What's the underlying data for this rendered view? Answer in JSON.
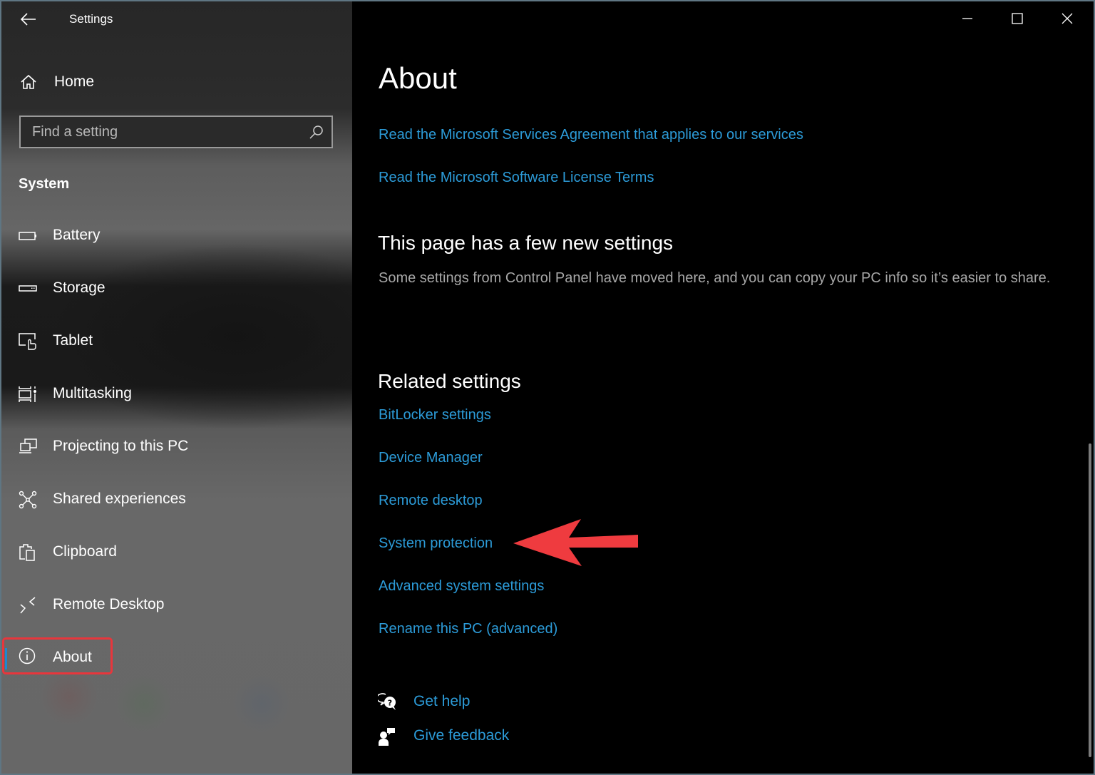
{
  "window": {
    "title": "Settings",
    "controls": {
      "minimize": "minimize-icon",
      "maximize": "maximize-icon",
      "close": "close-icon"
    }
  },
  "sidebar": {
    "back_icon": "back-arrow-icon",
    "home_label": "Home",
    "search": {
      "placeholder": "Find a setting",
      "value": ""
    },
    "section_title": "System",
    "items": [
      {
        "label": "Battery",
        "icon": "battery-icon"
      },
      {
        "label": "Storage",
        "icon": "storage-icon"
      },
      {
        "label": "Tablet",
        "icon": "tablet-icon"
      },
      {
        "label": "Multitasking",
        "icon": "multitasking-icon"
      },
      {
        "label": "Projecting to this PC",
        "icon": "projecting-icon"
      },
      {
        "label": "Shared experiences",
        "icon": "shared-experiences-icon"
      },
      {
        "label": "Clipboard",
        "icon": "clipboard-icon"
      },
      {
        "label": "Remote Desktop",
        "icon": "remote-desktop-icon"
      },
      {
        "label": "About",
        "icon": "info-icon",
        "selected": true
      }
    ]
  },
  "main": {
    "page_title": "About",
    "top_links": [
      "Read the Microsoft Services Agreement that applies to our services",
      "Read the Microsoft Software License Terms"
    ],
    "new_settings": {
      "heading": "This page has a few new settings",
      "description": "Some settings from Control Panel have moved here, and you can copy your PC info so it’s easier to share."
    },
    "related": {
      "heading": "Related settings",
      "links": [
        "BitLocker settings",
        "Device Manager",
        "Remote desktop",
        "System protection",
        "Advanced system settings",
        "Rename this PC (advanced)"
      ]
    },
    "help": {
      "get_help": "Get help",
      "give_feedback": "Give feedback"
    }
  },
  "annotations": {
    "highlight_color": "#e8363c",
    "arrow_target": "System protection",
    "highlight_target": "About"
  },
  "colors": {
    "link": "#2c9bd8",
    "accent": "#1e88d0",
    "annotation": "#e8363c"
  }
}
